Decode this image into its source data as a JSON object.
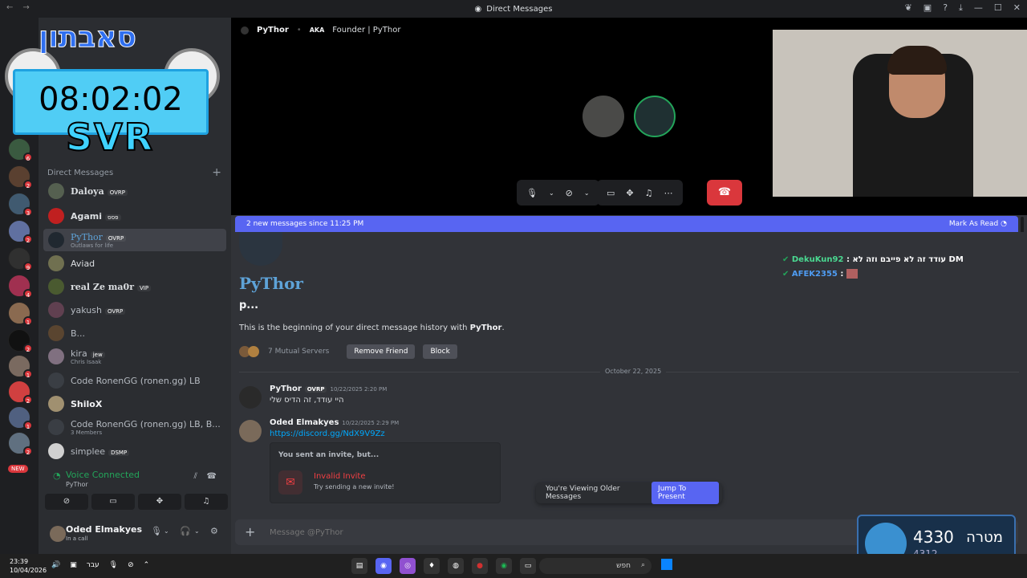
{
  "window": {
    "title": "Direct Messages"
  },
  "clock_overlay": {
    "heb_title": "סאבתון",
    "time": "08:02:02",
    "label": "SVR"
  },
  "servers": {
    "new_label": "NEW"
  },
  "sidebar": {
    "dm_header": "Direct Messages",
    "dms": [
      {
        "name": "Daloya",
        "tag": "OVRP",
        "sub": ""
      },
      {
        "name": "Agami",
        "tag": "פסס",
        "sub": ""
      },
      {
        "name": "PyThor",
        "tag": "OVRP",
        "sub": "Outlaws for life"
      },
      {
        "name": "Aviad",
        "tag": "",
        "sub": ""
      },
      {
        "name": "real Ze ma0r",
        "tag": "VIP",
        "sub": ""
      },
      {
        "name": "yakush",
        "tag": "OVRP",
        "sub": ""
      },
      {
        "name": "B...",
        "tag": "",
        "sub": ""
      },
      {
        "name": "kira",
        "tag": "jew",
        "sub": "Chris Isaak"
      },
      {
        "name": "Code RonenGG (ronen.gg) LB",
        "tag": "",
        "sub": ""
      },
      {
        "name": "ShiloX",
        "tag": "",
        "sub": ""
      },
      {
        "name": "Code RonenGG (ronen.gg) LB, B...",
        "tag": "",
        "sub": "3 Members"
      },
      {
        "name": "simplee",
        "tag": "DSMP",
        "sub": ""
      }
    ]
  },
  "voice": {
    "title": "Voice Connected",
    "channel": "PyThor"
  },
  "user": {
    "name": "Oded Elmakyes",
    "status": "In a call"
  },
  "call": {
    "name": "PyThor",
    "aka": "AKA",
    "aka_value": "Founder | PyThor"
  },
  "banner": {
    "text": "2 new messages since 11:25 PM",
    "action": "Mark As Read"
  },
  "profile": {
    "name": "PyThor",
    "status": "p...",
    "intro_prefix": "This is the beginning of your direct message history with ",
    "intro_name": "PyThor",
    "intro_suffix": ".",
    "mutual": "7 Mutual Servers",
    "remove_friend": "Remove Friend",
    "block": "Block"
  },
  "divider_date": "October 22, 2025",
  "messages": [
    {
      "author": "PyThor",
      "tag": "OVRP",
      "time": "10/22/2025 2:20 PM",
      "text": "היי עודד, זה הדיס שלי"
    },
    {
      "author": "Oded Elmakyes",
      "tag": "",
      "time": "10/22/2025 2:29 PM",
      "text": "https://discord.gg/NdX9V9Zz"
    }
  ],
  "invite": {
    "header": "You sent an invite, but...",
    "title": "Invalid Invite",
    "subtitle": "Try sending a new invite!"
  },
  "older": {
    "text": "You're Viewing Older Messages",
    "jump": "Jump To Present"
  },
  "overlay_chat": [
    {
      "user": "DekuKun92",
      "text": "עודד זה לא פייבם וזה לא DM"
    },
    {
      "user": "AFEK2355",
      "text": ""
    }
  ],
  "composer": {
    "placeholder": "Message @PyThor"
  },
  "goal": {
    "current": "4330",
    "label": "מטרה",
    "sub": "4312"
  },
  "taskbar": {
    "time": "23:39",
    "date": "10/04/2026",
    "lang": "עבר",
    "search": "חפש"
  },
  "colors": {
    "accent": "#5865f2",
    "danger": "#da373c",
    "online": "#23a55a",
    "link": "#00a8fc"
  }
}
